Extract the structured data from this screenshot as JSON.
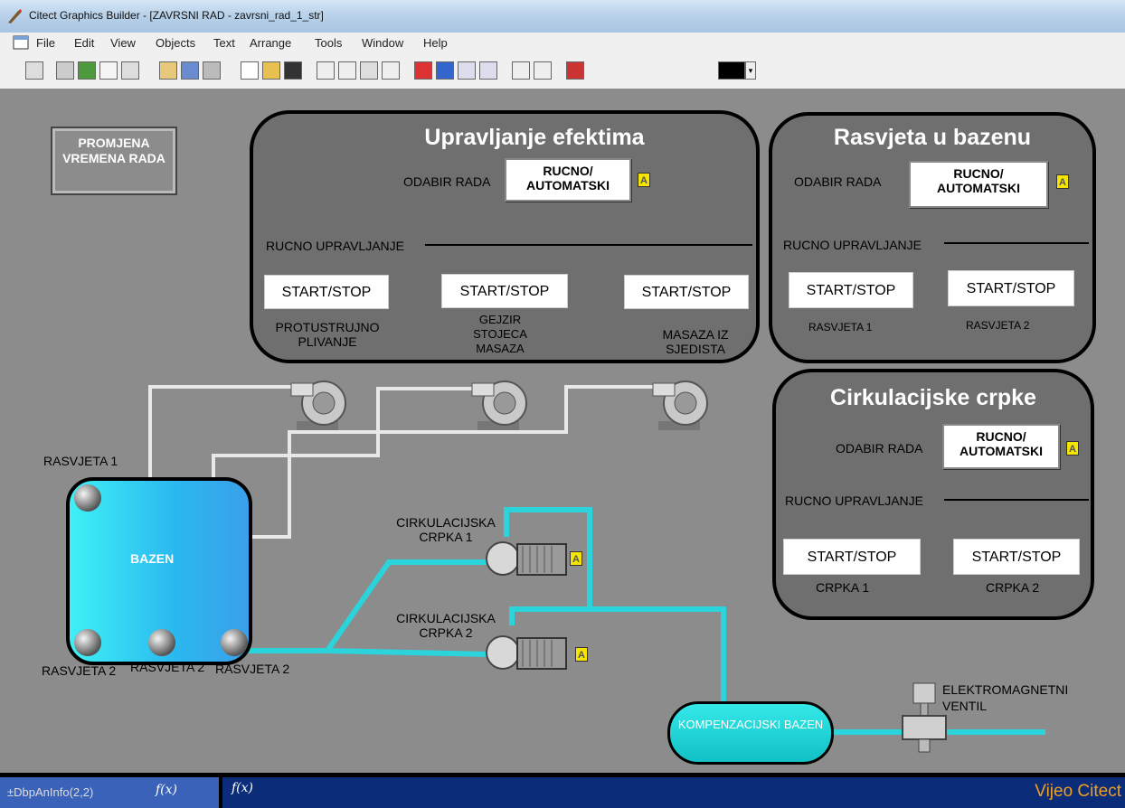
{
  "window": {
    "title": "Citect Graphics Builder - [ZAVRSNI RAD - zavrsni_rad_1_str]"
  },
  "menu": [
    "File",
    "Edit",
    "View",
    "Objects",
    "Text",
    "Arrange",
    "Tools",
    "Window",
    "Help"
  ],
  "promjena_label": "PROMJENA VREMENA RADA",
  "efekti": {
    "title": "Upravljanje efektima",
    "odabir": "ODABIR RADA",
    "mode_btn": "RUCNO/ AUTOMATSKI",
    "ind": "A",
    "rucno": "RUCNO UPRAVLJANJE",
    "buttons": [
      "START/STOP",
      "START/STOP",
      "START/STOP"
    ],
    "labels": [
      "PROTUSTRUJNO PLIVANJE",
      "GEJZIR STOJECA MASAZA",
      "MASAZA IZ SJEDISTA"
    ]
  },
  "rasvjeta": {
    "title": "Rasvjeta u bazenu",
    "odabir": "ODABIR RADA",
    "mode_btn": "RUCNO/ AUTOMATSKI",
    "ind": "A",
    "rucno": "RUCNO UPRAVLJANJE",
    "buttons": [
      "START/STOP",
      "START/STOP"
    ],
    "labels": [
      "RASVJETA 1",
      "RASVJETA 2"
    ]
  },
  "cirk": {
    "title": "Cirkulacijske crpke",
    "odabir": "ODABIR RADA",
    "mode_btn": "RUCNO/ AUTOMATSKI",
    "ind": "A",
    "rucno": "RUCNO UPRAVLJANJE",
    "buttons": [
      "START/STOP",
      "START/STOP"
    ],
    "labels": [
      "CRPKA 1",
      "CRPKA 2"
    ]
  },
  "diagram": {
    "rasvjeta1": "RASVJETA 1",
    "bazen": "BAZEN",
    "rasvjeta2": [
      "RASVJETA 2",
      "RASVJETA 2",
      "RASVJETA 2"
    ],
    "pump1": "CIRKULACIJSKA CRPKA 1",
    "pump2": "CIRKULACIJSKA CRPKA 2",
    "pump_ind": "A",
    "komp": "KOMPENZACIJSKI BAZEN",
    "ventil": "ELEKTROMAGNETNI VENTIL"
  },
  "status": {
    "left": "±DbpAnInfo(2,2)",
    "fx1": "f(x)",
    "fx2": "f(x)",
    "brand": "Vijeo Citect"
  },
  "colors": {
    "pipe": "#2ad4da",
    "panel": "#6f6f6f",
    "canvas": "#8c8c8c",
    "indicator": "#f5e500"
  }
}
